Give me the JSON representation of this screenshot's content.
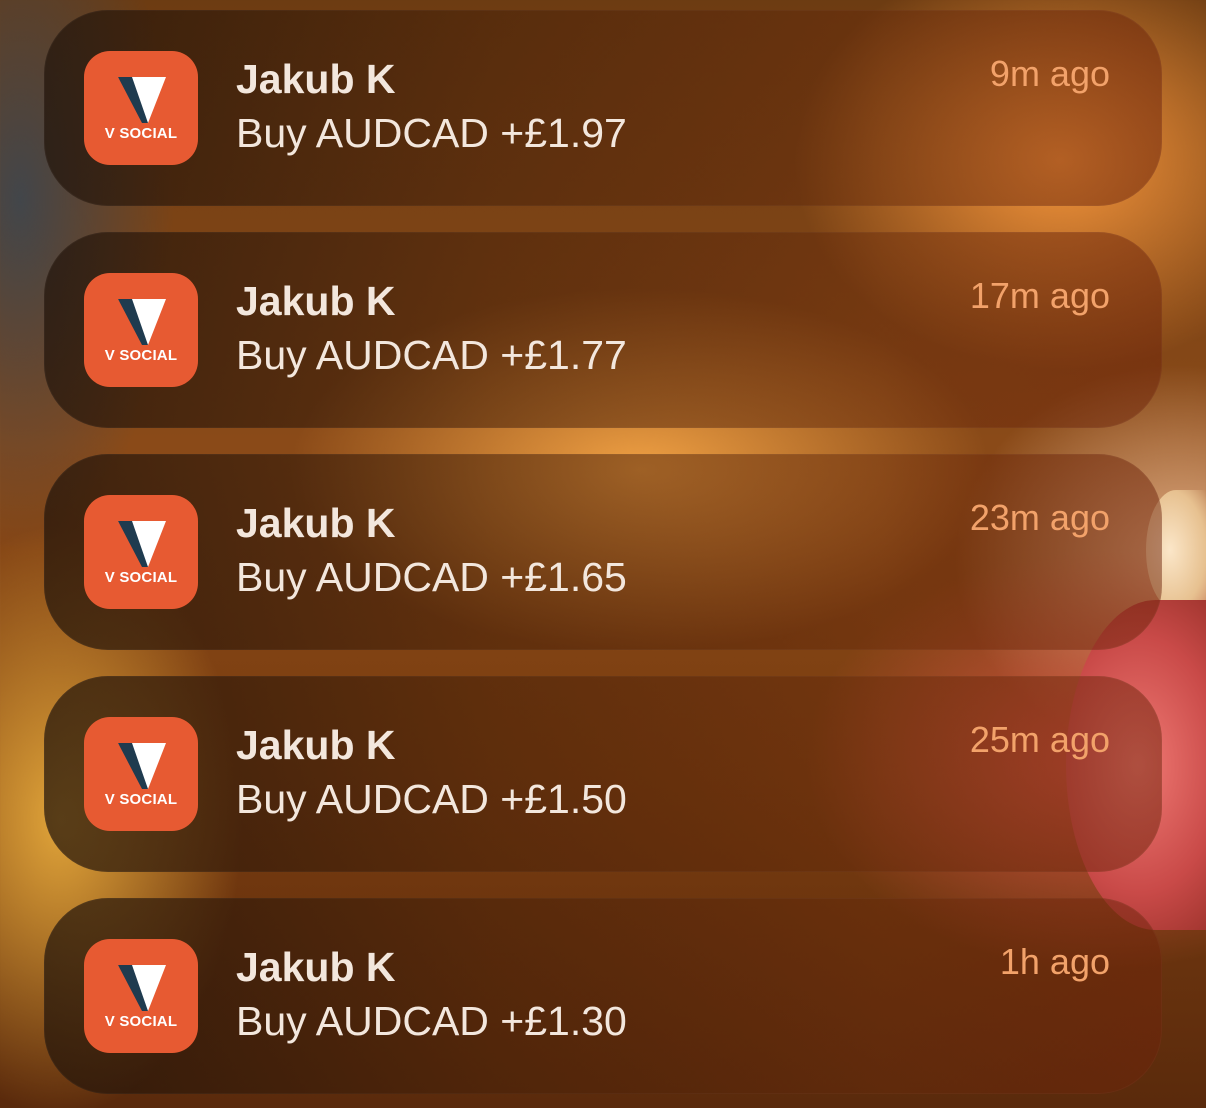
{
  "theme": {
    "icon_color": "#e75a32",
    "icon_mark_dark": "#1f3b4f",
    "text_color": "#f3e7dd",
    "time_color": "#f2a26a"
  },
  "notifications": [
    {
      "app_icon": "v-social-logo-icon",
      "app_label": "V SOCIAL",
      "sender": "Jakub K",
      "message": "Buy AUDCAD +£1.97",
      "time": "9m ago"
    },
    {
      "app_icon": "v-social-logo-icon",
      "app_label": "V SOCIAL",
      "sender": "Jakub K",
      "message": "Buy AUDCAD +£1.77",
      "time": "17m ago"
    },
    {
      "app_icon": "v-social-logo-icon",
      "app_label": "V SOCIAL",
      "sender": "Jakub K",
      "message": "Buy AUDCAD +£1.65",
      "time": "23m ago"
    },
    {
      "app_icon": "v-social-logo-icon",
      "app_label": "V SOCIAL",
      "sender": "Jakub K",
      "message": "Buy AUDCAD +£1.50",
      "time": "25m ago"
    },
    {
      "app_icon": "v-social-logo-icon",
      "app_label": "V SOCIAL",
      "sender": "Jakub K",
      "message": "Buy AUDCAD +£1.30",
      "time": "1h ago"
    }
  ]
}
